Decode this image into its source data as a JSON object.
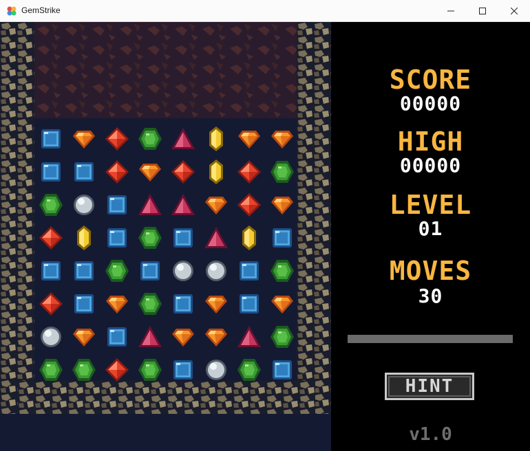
{
  "window": {
    "title": "GemStrike",
    "icons": {
      "app": "palette-icon",
      "minimize": "minimize-icon",
      "maximize": "maximize-icon",
      "close": "close-icon"
    }
  },
  "panel": {
    "score_label": "SCORE",
    "score_value": "00000",
    "high_label": "HIGH",
    "high_value": "00000",
    "level_label": "LEVEL",
    "level_value": "01",
    "moves_label": "MOVES",
    "moves_value": "30",
    "progress": 0,
    "hint_label": "HINT",
    "version": "v1.0"
  },
  "colors": {
    "label": "#f9b640",
    "value": "#ffffff",
    "board_bg": "#151a33",
    "bar": "#6b6b6b"
  },
  "board": {
    "legend": {
      "B": "blue-square-gem",
      "O": "orange-diamond-gem",
      "R": "red-rhombus-gem",
      "G": "green-hexagon-gem",
      "P": "pink-triangle-gem",
      "Y": "yellow-crystal-gem",
      "W": "white-orb-gem"
    },
    "rows": [
      [
        "B",
        "O",
        "R",
        "G",
        "P",
        "Y",
        "O",
        "O"
      ],
      [
        "B",
        "B",
        "R",
        "O",
        "R",
        "Y",
        "R",
        "G"
      ],
      [
        "G",
        "W",
        "B",
        "P",
        "P",
        "O",
        "R",
        "O"
      ],
      [
        "R",
        "Y",
        "B",
        "G",
        "B",
        "P",
        "Y",
        "B"
      ],
      [
        "B",
        "B",
        "G",
        "B",
        "W",
        "W",
        "B",
        "G"
      ],
      [
        "R",
        "B",
        "O",
        "G",
        "B",
        "O",
        "B",
        "O"
      ],
      [
        "W",
        "O",
        "B",
        "P",
        "O",
        "O",
        "P",
        "G"
      ],
      [
        "G",
        "G",
        "R",
        "G",
        "B",
        "W",
        "G",
        "B"
      ]
    ]
  }
}
